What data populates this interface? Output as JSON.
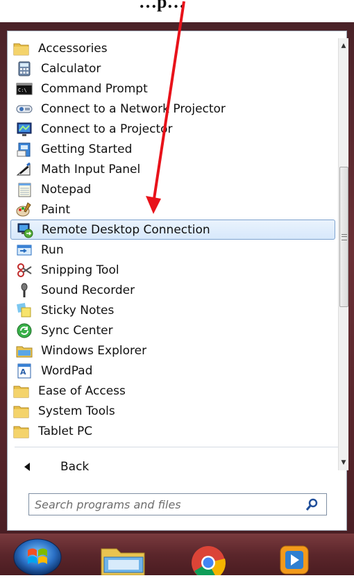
{
  "caption": {
    "text": "…p…"
  },
  "menu": {
    "items": [
      {
        "label": "Accessories",
        "icon": "folder-icon",
        "kind": "folder"
      },
      {
        "label": "Calculator",
        "icon": "calculator-icon"
      },
      {
        "label": "Command Prompt",
        "icon": "command-prompt-icon"
      },
      {
        "label": "Connect to a Network Projector",
        "icon": "network-projector-icon"
      },
      {
        "label": "Connect to a Projector",
        "icon": "projector-icon"
      },
      {
        "label": "Getting Started",
        "icon": "getting-started-icon"
      },
      {
        "label": "Math Input Panel",
        "icon": "math-input-icon"
      },
      {
        "label": "Notepad",
        "icon": "notepad-icon"
      },
      {
        "label": "Paint",
        "icon": "paint-icon"
      },
      {
        "label": "Remote Desktop Connection",
        "icon": "remote-desktop-icon",
        "selected": true
      },
      {
        "label": "Run",
        "icon": "run-icon"
      },
      {
        "label": "Snipping Tool",
        "icon": "snipping-tool-icon"
      },
      {
        "label": "Sound Recorder",
        "icon": "microphone-icon"
      },
      {
        "label": "Sticky Notes",
        "icon": "sticky-notes-icon"
      },
      {
        "label": "Sync Center",
        "icon": "sync-icon"
      },
      {
        "label": "Windows Explorer",
        "icon": "explorer-icon"
      },
      {
        "label": "WordPad",
        "icon": "wordpad-icon"
      },
      {
        "label": "Ease of Access",
        "icon": "folder-icon",
        "kind": "folder"
      },
      {
        "label": "System Tools",
        "icon": "folder-icon",
        "kind": "folder"
      },
      {
        "label": "Tablet PC",
        "icon": "folder-icon",
        "kind": "folder"
      }
    ],
    "back_label": "Back",
    "search_placeholder": "Search programs and files"
  },
  "taskbar": {
    "buttons": [
      "start-orb-icon",
      "file-explorer-icon",
      "chrome-icon",
      "media-player-icon"
    ]
  },
  "colors": {
    "annotation_arrow": "#e8121a",
    "selection": "#d7e8fb",
    "frame": "#5b262b"
  }
}
